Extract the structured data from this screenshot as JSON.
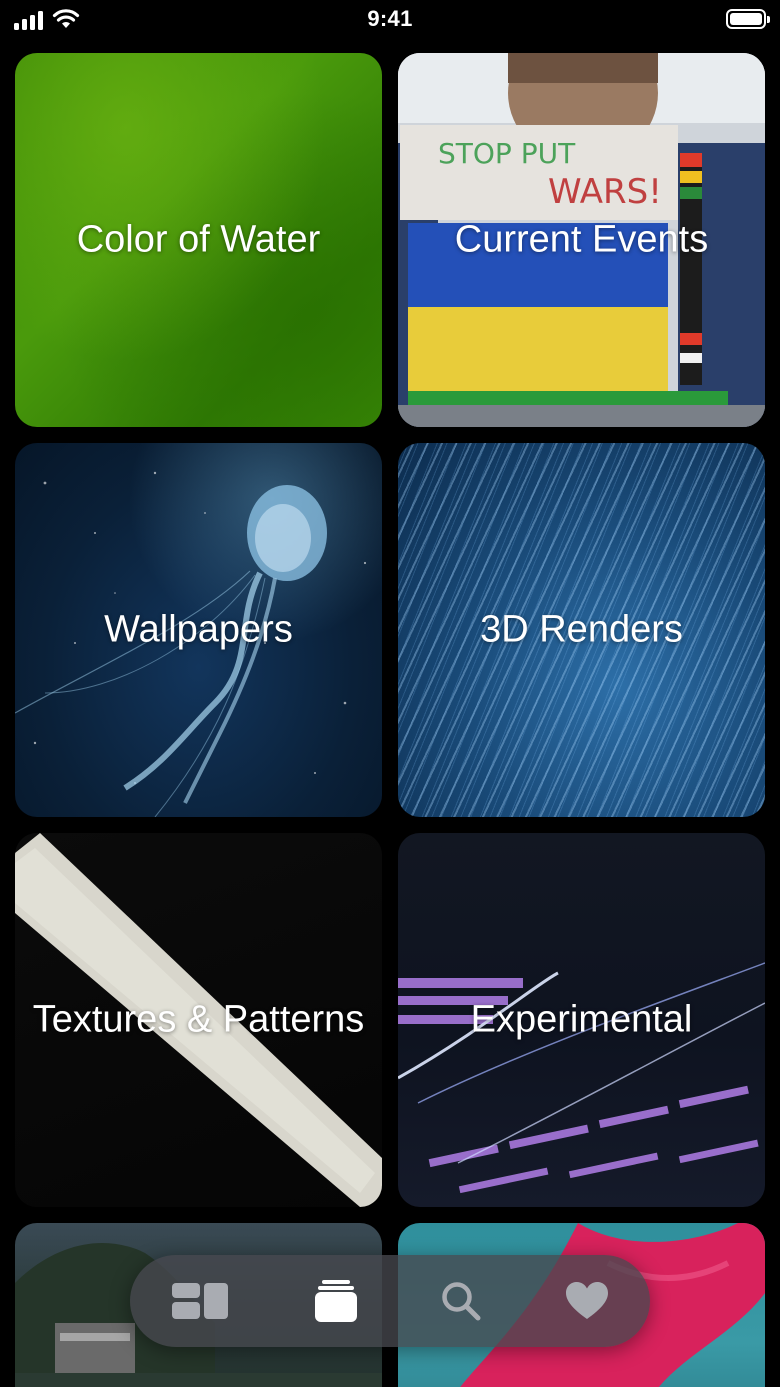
{
  "status_bar": {
    "time": "9:41"
  },
  "tiles": [
    {
      "label": "Color of Water"
    },
    {
      "label": "Current Events"
    },
    {
      "label": "Wallpapers"
    },
    {
      "label": "3D Renders"
    },
    {
      "label": "Textures & Patterns"
    },
    {
      "label": "Experimental"
    },
    {
      "label": ""
    },
    {
      "label": ""
    }
  ],
  "tab_bar": {
    "tabs": [
      {
        "icon": "browse-icon",
        "selected": false
      },
      {
        "icon": "collections-icon",
        "selected": true
      },
      {
        "icon": "search-icon",
        "selected": false
      },
      {
        "icon": "heart-icon",
        "selected": false
      }
    ]
  },
  "colors": {
    "background": "#000000",
    "tab_selected": "#ffffff",
    "tab_unselected": "#a9acb2"
  }
}
